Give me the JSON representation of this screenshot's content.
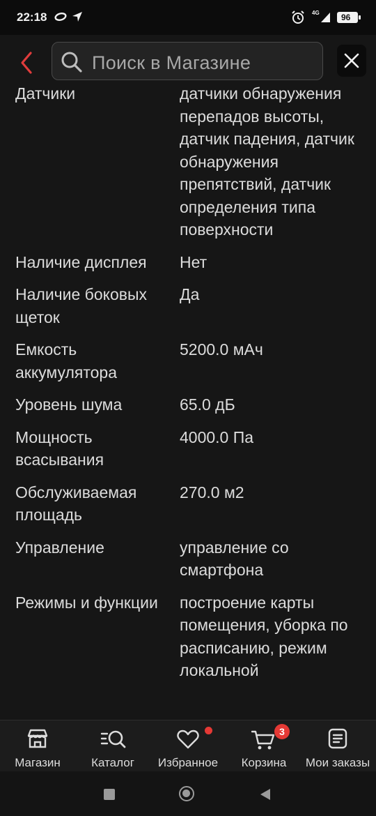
{
  "status_bar": {
    "time": "22:18",
    "network": "4G",
    "battery": "96"
  },
  "search": {
    "placeholder": "Поиск в Магазине"
  },
  "specs": [
    {
      "label": "Датчики",
      "value": "датчики обнаружения перепадов высоты, датчик падения, датчик обнаружения препятствий, датчик определения типа поверхности"
    },
    {
      "label": "Наличие дисплея",
      "value": "Нет"
    },
    {
      "label": "Наличие боковых щеток",
      "value": "Да"
    },
    {
      "label": "Емкость аккумулятора",
      "value": "5200.0 мАч"
    },
    {
      "label": "Уровень шума",
      "value": "65.0 дБ"
    },
    {
      "label": "Мощность всасывания",
      "value": "4000.0 Па"
    },
    {
      "label": "Обслуживаемая площадь",
      "value": "270.0 м2"
    },
    {
      "label": "Управление",
      "value": "управление со смартфона"
    },
    {
      "label": "Режимы и функции",
      "value": "построение карты помещения, уборка по расписанию, режим локальной"
    }
  ],
  "bottom_nav": {
    "items": [
      {
        "label": "Магазин",
        "icon": "store-icon"
      },
      {
        "label": "Каталог",
        "icon": "catalog-search-icon"
      },
      {
        "label": "Избранное",
        "icon": "heart-icon"
      },
      {
        "label": "Корзина",
        "icon": "cart-icon"
      },
      {
        "label": "Мои заказы",
        "icon": "orders-icon"
      }
    ],
    "cart_count": "3"
  },
  "colors": {
    "accent": "#e53935",
    "background": "#161616"
  }
}
